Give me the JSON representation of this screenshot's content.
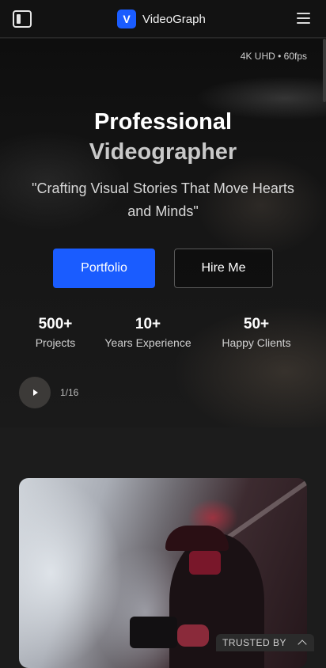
{
  "header": {
    "logo_letter": "V",
    "brand_name": "VideoGraph",
    "accent": "#1a5cff",
    "left_icon": "sidebar-toggle-icon",
    "right_icon": "hamburger-menu-icon"
  },
  "hero": {
    "quality_badge": "4K UHD • 60fps",
    "title_line1": "Professional",
    "title_line2": "Videographer",
    "tagline": "\"Crafting Visual Stories That Move Hearts and Minds\"",
    "primary_button": "Portfolio",
    "secondary_button": "Hire Me",
    "stats": [
      {
        "value": "500+",
        "label": "Projects"
      },
      {
        "value": "10+",
        "label": "Years Experience"
      },
      {
        "value": "50+",
        "label": "Happy Clients"
      }
    ],
    "slide_counter": "1/16",
    "play_icon": "play-icon"
  },
  "footer_tab": {
    "label": "TRUSTED BY",
    "icon": "chevron-up-icon"
  }
}
